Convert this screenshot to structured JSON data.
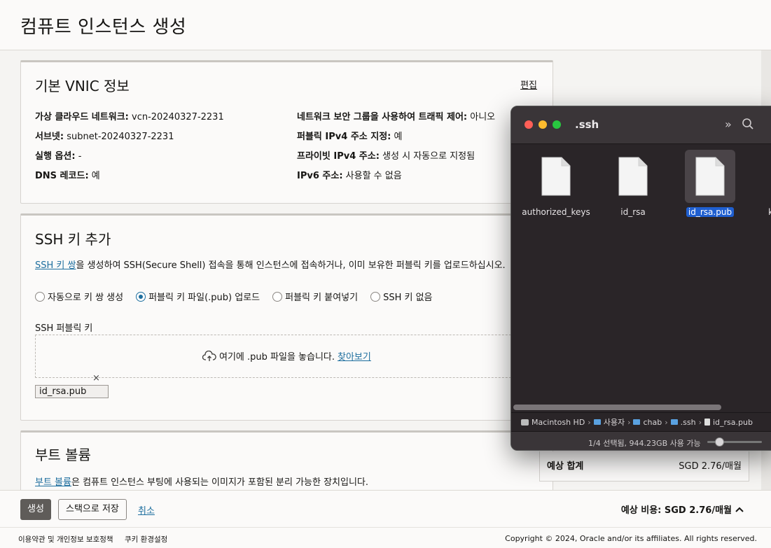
{
  "page": {
    "title": "컴퓨트 인스턴스 생성"
  },
  "vnic": {
    "heading": "기본 VNIC 정보",
    "edit": "편집",
    "left": [
      {
        "label": "가상 클라우드 네트워크:",
        "value": "vcn-20240327-2231"
      },
      {
        "label": "서브넷:",
        "value": "subnet-20240327-2231"
      },
      {
        "label": "실행 옵션:",
        "value": "-"
      },
      {
        "label": "DNS 레코드:",
        "value": "예"
      }
    ],
    "right": [
      {
        "label": "네트워크 보안 그룹을 사용하여 트래픽 제어:",
        "value": "아니오"
      },
      {
        "label": "퍼블릭 IPv4 주소 지정:",
        "value": "예"
      },
      {
        "label": "프라이빗 IPv4 주소:",
        "value": "생성 시 자동으로 지정됨"
      },
      {
        "label": "IPv6 주소:",
        "value": "사용할 수 없음"
      }
    ]
  },
  "ssh": {
    "heading": "SSH 키 추가",
    "desc_link": "SSH 키 쌍",
    "desc_rest": "을 생성하여 SSH(Secure Shell) 접속을 통해 인스턴스에 접속하거나, 이미 보유한 퍼블릭 키를 업로드하십시오.",
    "options": [
      "자동으로 키 쌍 생성",
      "퍼블릭 키 파일(.pub) 업로드",
      "퍼블릭 키 붙여넣기",
      "SSH 키 없음"
    ],
    "selected_index": 1,
    "field_label": "SSH 퍼블릭 키",
    "drop_text": "여기에 .pub 파일을 놓습니다.",
    "browse": "찾아보기",
    "remove": "×",
    "file": "id_rsa.pub"
  },
  "boot": {
    "heading": "부트 볼륨",
    "desc_link": "부트 볼륨",
    "desc_rest": "은 컴퓨트 인스턴스 부팅에 사용되는 이미지가 포함된 분리 가능한 장치입니다."
  },
  "estimate": {
    "label": "예상 합계",
    "value": "SGD 2.76/매월"
  },
  "footer": {
    "create": "생성",
    "save_stack": "스택으로 저장",
    "cancel": "취소",
    "est_cost": "예상 비용: SGD 2.76/매월",
    "chevron": "^"
  },
  "legal": {
    "terms": "이용약관 및 개인정보 보호정책",
    "cookies": "쿠키 환경설정",
    "copyright": "Copyright © 2024, Oracle and/or its affiliates. All rights reserved."
  },
  "finder": {
    "title": ".ssh",
    "more": "»",
    "files": [
      "authorized_keys",
      "id_rsa",
      "id_rsa.pub",
      "kno"
    ],
    "selected_file_index": 2,
    "path": [
      "Macintosh HD",
      "사용자",
      "chab",
      ".ssh",
      "id_rsa.pub"
    ],
    "status": "1/4 선택됨, 944.23GB 사용 가능",
    "colors": {
      "close": "#ff5f57",
      "minimize": "#febc2e",
      "zoom": "#28c840",
      "selection": "#1f5fd0"
    }
  }
}
